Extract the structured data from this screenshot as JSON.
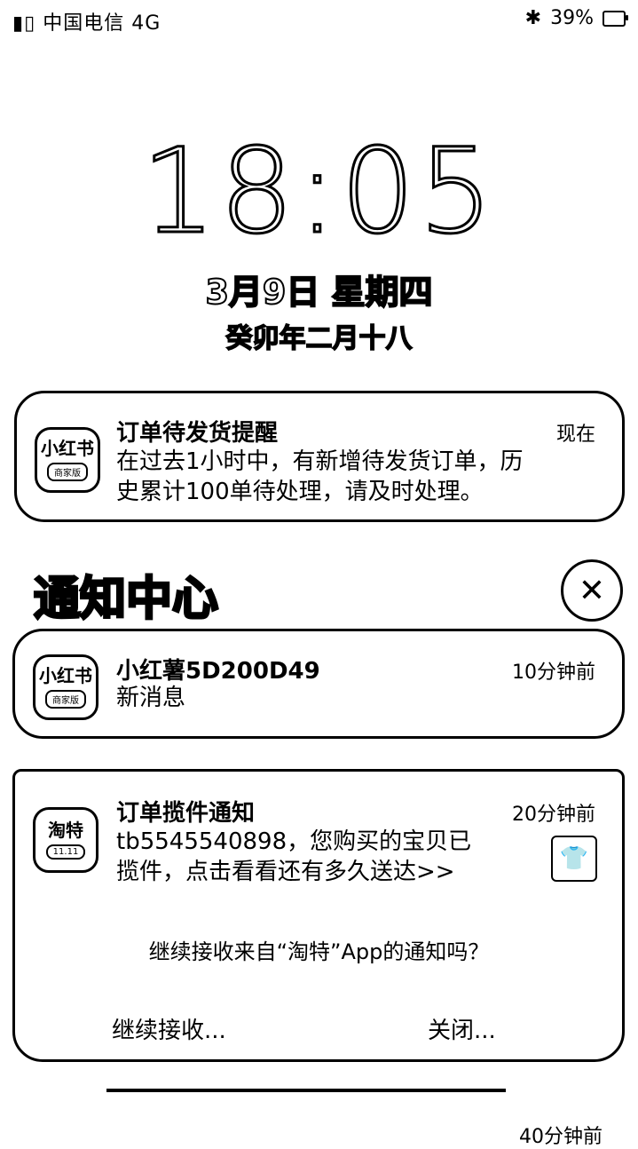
{
  "status_bar": {
    "left": "中国电信 4G",
    "right": "39%"
  },
  "lock_screen": {
    "time": "18:05",
    "date": "3月9日 星期四",
    "lunar_date": "癸卯年二月十八"
  },
  "top_notification": {
    "app_icon_text": "小红书",
    "app_icon_sub": "商家版",
    "title": "订单待发货提醒",
    "time": "现在",
    "body_line1": "在过去1小时中，有新增待发货订单，历",
    "body_line2": "史累计100单待处理，请及时处理。"
  },
  "notification_center": {
    "title": "通知中心",
    "close_icon": "close-icon"
  },
  "notifications": [
    {
      "app_icon_text": "小红书",
      "app_icon_sub": "商家版",
      "title": "小红薯5D200D49",
      "time": "10分钟前",
      "body": "新消息"
    },
    {
      "app_icon_text": "淘特",
      "app_icon_sub": "11.11",
      "title": "订单揽件通知",
      "time": "20分钟前",
      "body_line1": "tb5545540898，您购买的宝贝已",
      "body_line2": "揽件，点击看看还有多久送达>>",
      "prompt": "继续接收来自“淘特”App的通知吗？",
      "keep_label": "继续接收...",
      "close_label": "关闭..."
    }
  ],
  "bottom_peek_time": "40分钟前"
}
